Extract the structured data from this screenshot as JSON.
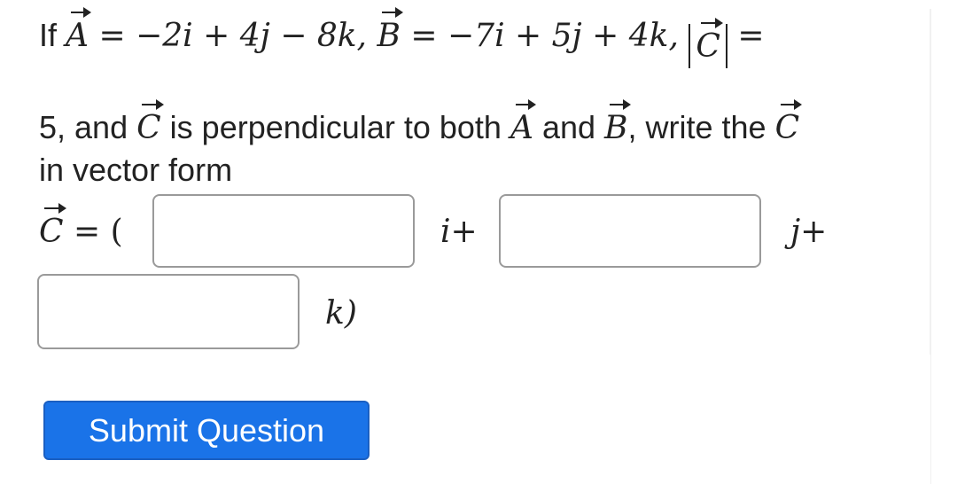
{
  "question": {
    "line1": {
      "if": "If",
      "vector_a_letter": "A",
      "eq_a": "= −2i + 4j − 8k,",
      "vector_b_letter": "B",
      "eq_b": "= −7i + 5j + 4k,",
      "abs_vector_c_letter": "C",
      "eq_c": "="
    },
    "line2": {
      "text_a": "5, and",
      "vector_c_letter": "C",
      "text_b": "is perpendicular to both",
      "vector_a_letter": "A",
      "text_c": "and",
      "vector_b_letter": "B",
      "text_d": ", write the",
      "vector_c_letter_2": "C"
    },
    "line3": "in vector form"
  },
  "answer": {
    "vector_c_letter": "C",
    "lhs": "= (",
    "i_suffix": "i+",
    "j_suffix": "j+",
    "k_suffix": "k)",
    "i_value": "",
    "j_value": "",
    "k_value": ""
  },
  "submit": {
    "label": "Submit Question"
  }
}
